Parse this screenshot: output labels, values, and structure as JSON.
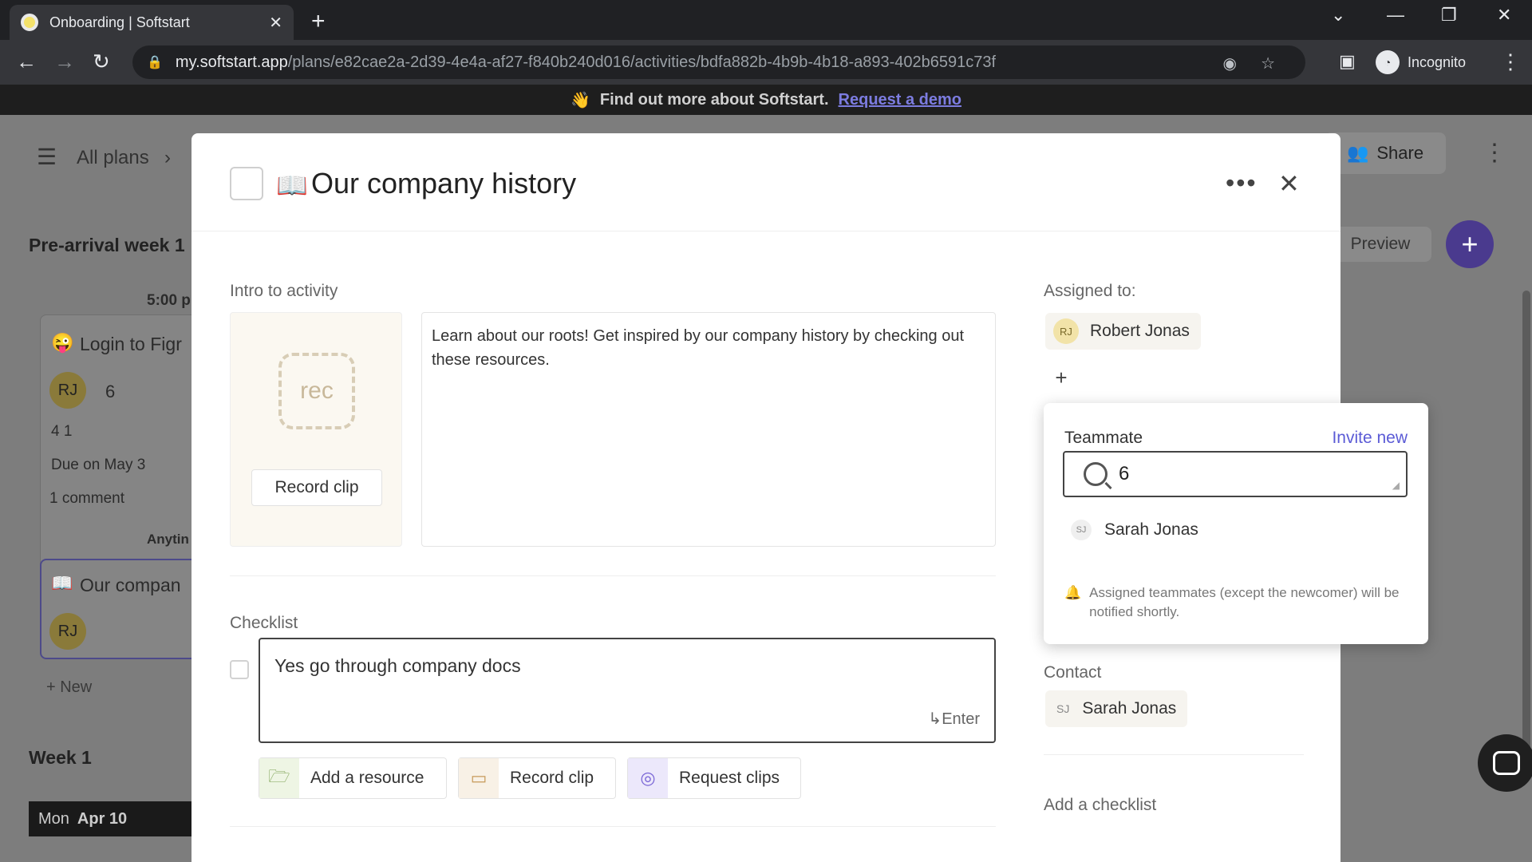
{
  "browser": {
    "tab_title": "Onboarding | Softstart",
    "url_host": "my.softstart.app",
    "url_path": "/plans/e82cae2a-2d39-4e4a-af27-f840b240d016/activities/bdfa882b-4b9b-4b18-a893-402b6591c73f",
    "profile_label": "Incognito"
  },
  "banner": {
    "text": "Find out more about Softstart.",
    "link": "Request a demo"
  },
  "background": {
    "breadcrumb": "All plans",
    "share_label": "Share",
    "preview_label": "Preview",
    "section_1": "Pre-arrival week 1",
    "time_label": "5:00 p",
    "card1_title": "Login to Figr",
    "card1_avatar": "RJ",
    "card1_count": "6",
    "card1_meta": "4  1",
    "card1_due": "Due on May 3",
    "card1_comments": "1 comment",
    "anytime_label": "Anytin",
    "card2_title": "Our compan",
    "card2_avatar": "RJ",
    "new_label": "+ New",
    "section_2": "Week 1",
    "date_day": "Mon",
    "date_value": "Apr 10"
  },
  "modal": {
    "title": "Our company history",
    "intro_label": "Intro to activity",
    "rec_text": "rec",
    "record_clip": "Record clip",
    "intro_text": "Learn about our roots! Get inspired by our company history by checking out these resources.",
    "checklist_label": "Checklist",
    "checklist_item": "Yes go through company docs",
    "enter_hint": "Enter",
    "tools": {
      "add_resource": "Add a resource",
      "record_clip": "Record clip",
      "request_clips": "Request clips"
    },
    "assigned_label": "Assigned to:",
    "assignee": {
      "initials": "RJ",
      "name": "Robert Jonas"
    },
    "popover": {
      "label": "Teammate",
      "invite": "Invite new",
      "search_value": "6",
      "option": {
        "initials": "SJ",
        "name": "Sarah Jonas"
      },
      "note": "Assigned teammates (except the newcomer) will be notified shortly."
    },
    "contact_label": "Contact",
    "contact": {
      "initials": "SJ",
      "name": "Sarah Jonas"
    },
    "add_checklist": "Add a checklist"
  }
}
